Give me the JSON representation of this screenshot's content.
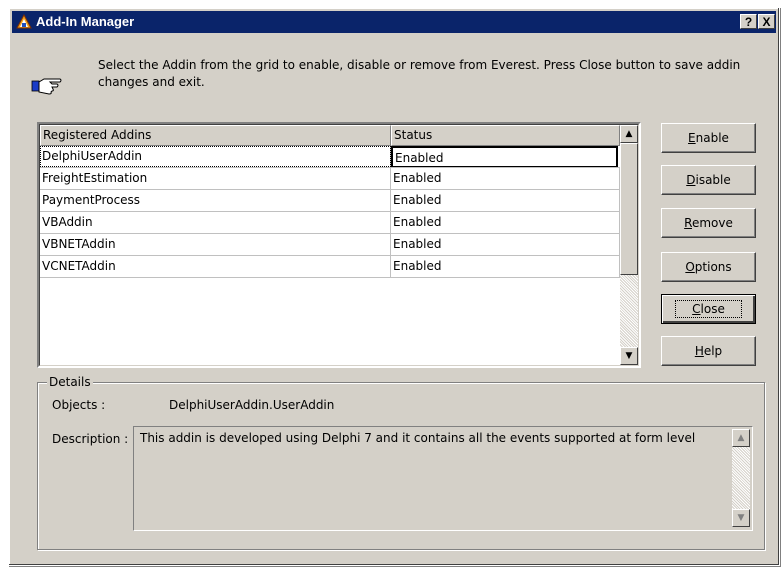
{
  "window": {
    "title": "Add-In Manager",
    "help_button": "?",
    "close_button": "X"
  },
  "instruction": "Select the Addin from the grid to enable, disable or remove from Everest. Press Close button to save addin changes and exit.",
  "grid": {
    "columns": [
      "Registered Addins",
      "Status"
    ],
    "rows": [
      {
        "name": "DelphiUserAddin",
        "status": "Enabled"
      },
      {
        "name": "FreightEstimation",
        "status": "Enabled"
      },
      {
        "name": "PaymentProcess",
        "status": "Enabled"
      },
      {
        "name": "VBAddin",
        "status": "Enabled"
      },
      {
        "name": "VBNETAddin",
        "status": "Enabled"
      },
      {
        "name": "VCNETAddin",
        "status": "Enabled"
      }
    ],
    "selected_row": "DelphiUserAddin"
  },
  "buttons": {
    "enable": {
      "accel": "E",
      "rest": "nable"
    },
    "disable": {
      "accel": "D",
      "rest": "isable"
    },
    "remove": {
      "accel": "R",
      "rest": "emove"
    },
    "options": {
      "accel": "O",
      "rest": "ptions"
    },
    "close": {
      "accel": "C",
      "rest": "lose"
    },
    "help": {
      "accel": "H",
      "rest": "elp"
    }
  },
  "details": {
    "group_title": "Details",
    "objects_label": "Objects :",
    "objects_value": "DelphiUserAddin.UserAddin",
    "description_label": "Description :",
    "description_value": "This addin is developed using Delphi 7 and it contains all the events supported at form level"
  },
  "colors": {
    "titlebar": "#0a246a",
    "dialog_face": "#d4d0c8"
  },
  "icons": [
    "add-in-manager-icon",
    "pointing-hand-icon",
    "scroll-up-arrow-icon",
    "scroll-down-arrow-icon"
  ]
}
